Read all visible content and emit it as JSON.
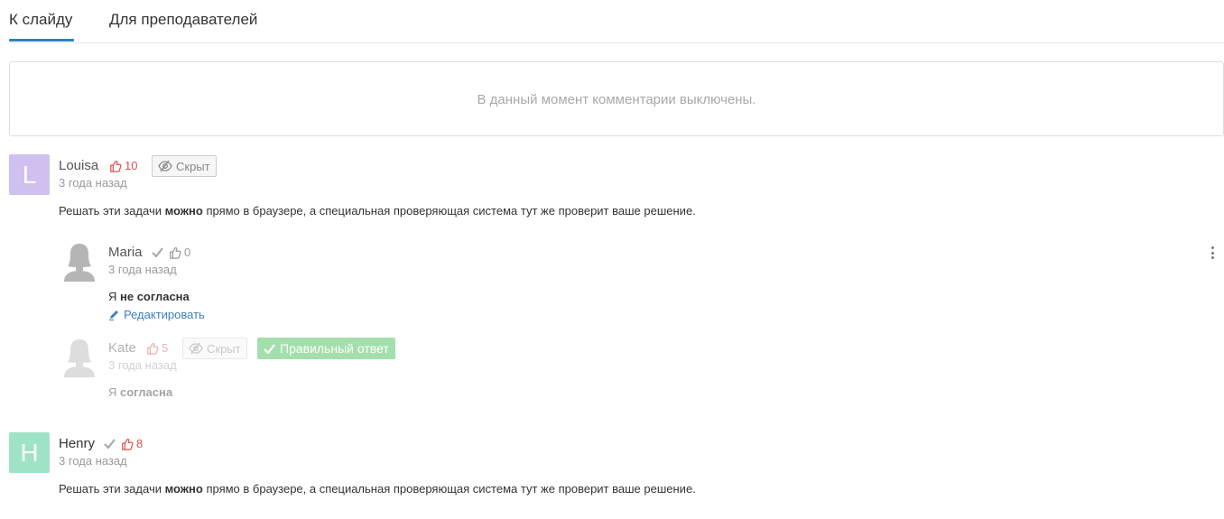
{
  "tabs": {
    "to_slide": "К слайду",
    "for_teachers": "Для преподавателей"
  },
  "notice": "В данный момент комментарии выключены.",
  "comments": [
    {
      "avatar_letter": "L",
      "avatar_color": "#cfc0f0",
      "author": "Louisa",
      "likes": "10",
      "hide_label": "Скрыт",
      "time": "3 года назад",
      "text_before": "Решать эти задачи ",
      "text_bold": "можно",
      "text_after": " прямо в браузере, а специальная проверяющая система тут же проверит ваше решение."
    },
    {
      "avatar_letter": "H",
      "avatar_color": "#9fe3c6",
      "author": "Henry",
      "likes": "8",
      "time": "3 года назад",
      "text_before": "Решать эти задачи ",
      "text_bold": "можно",
      "text_after": " прямо в браузере, а специальная проверяющая система тут же проверит ваше решение."
    }
  ],
  "replies": [
    {
      "author": "Maria",
      "likes": "0",
      "time": "3 года назад",
      "text_before": "Я ",
      "text_bold": "не согласна",
      "edit_label": "Редактировать"
    },
    {
      "author": "Kate",
      "likes": "5",
      "hide_label": "Скрыт",
      "correct_label": "Правильный ответ",
      "time": "3 года назад",
      "text_before": "Я ",
      "text_bold": "согласна"
    }
  ],
  "colors": {
    "accent": "#2a82c7",
    "like_red": "#d9534f",
    "correct_green": "#a3dfab",
    "link_blue": "#3f7ec0"
  }
}
